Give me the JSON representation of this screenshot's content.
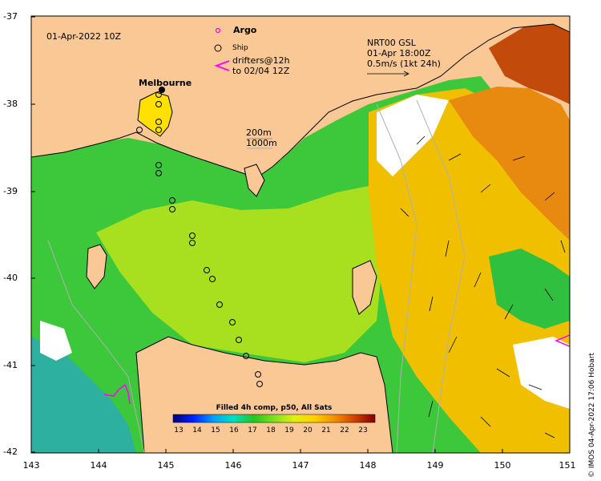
{
  "map": {
    "timestamp": "01-Apr-2022 10Z",
    "city": "Melbourne",
    "credit": "© IMOS 04-Apr-2022 17:06 Hobart",
    "isobaths": [
      "200m",
      "1000m"
    ],
    "legend": {
      "argo": "Argo",
      "ship": "Ship",
      "drifters_line1": "drifters@12h",
      "drifters_line2": "to 02/04 12Z"
    },
    "current_key": {
      "line1": "NRT00 GSL",
      "line2": "01-Apr 18:00Z",
      "line3": "0.5m/s (1kt 24h)"
    },
    "y_ticks": [
      "-37",
      "-38",
      "-39",
      "-40",
      "-41",
      "-42"
    ],
    "x_ticks": [
      "143",
      "144",
      "145",
      "146",
      "147",
      "148",
      "149",
      "150",
      "151"
    ],
    "colorbar": {
      "title": "Filled 4h comp, p50, All Sats",
      "ticks": [
        "13",
        "14",
        "15",
        "16",
        "17",
        "18",
        "19",
        "20",
        "21",
        "22",
        "23"
      ]
    },
    "colors": {
      "land": "#f9c895",
      "ocean_cool": "#2fc83a",
      "ocean_mid": "#b4e61e",
      "ocean_warm": "#f0a800",
      "ocean_hot": "#c0400a",
      "argo": "#ff00ff"
    },
    "ship_track_icon": "ship-circle-icon",
    "argo_icon": "argo-circle-icon",
    "drifter_icon": "drifter-arrow-icon"
  }
}
